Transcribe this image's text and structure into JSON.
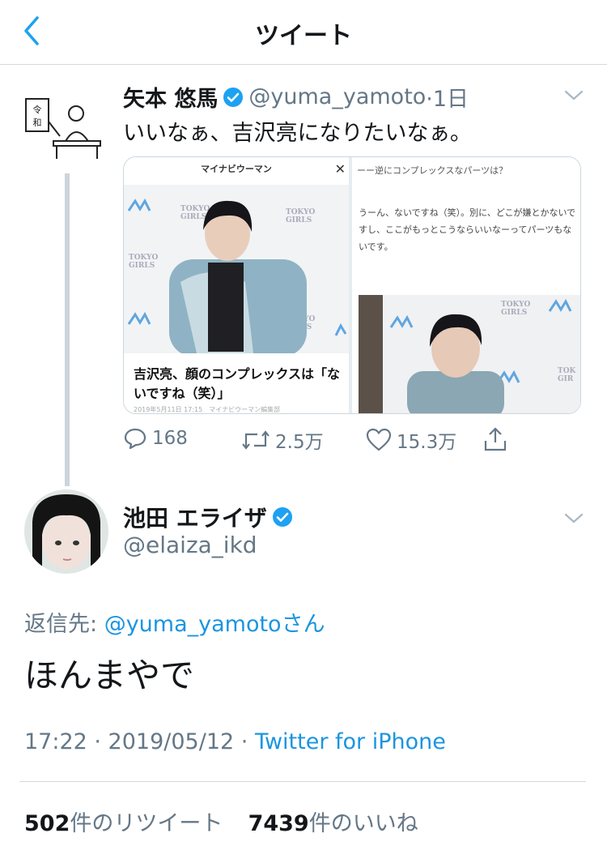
{
  "nav": {
    "title": "ツイート"
  },
  "quoted_tweet": {
    "name": "矢本 悠馬",
    "handle": "@yuma_yamoto",
    "time": "·1日",
    "text": "いいなぁ、吉沢亮になりたいなぁ。",
    "media": {
      "left_header": "マイナビウーマン",
      "left_close": "✕",
      "left_caption": "吉沢亮、顔のコンプレックスは「ないですね（笑）」",
      "left_meta": "2019年5月11日 17:15　マイナビウーマン編集部",
      "right_header": "ーー逆にコンプレックスなパーツは？",
      "right_text": "うーん、ないですね（笑）。別に、どこが嫌とかないですし、ここがもっとこうならいいなーってパーツもないです。"
    },
    "actions": {
      "replies": "168",
      "retweets": "2.5万",
      "likes": "15.3万"
    }
  },
  "main_tweet": {
    "name": "池田 エライザ",
    "handle": "@elaiza_ikd",
    "reply_prefix": "返信先: ",
    "reply_link": "@yuma_yamotoさん",
    "text": "ほんまやで",
    "timestamp": "17:22 · 2019/05/12 · ",
    "source": "Twitter for iPhone",
    "retweet_count": "502",
    "retweet_label": "件のリツイート",
    "like_count": "7439",
    "like_label": "件のいいね"
  },
  "colors": {
    "link": "#1b95e0",
    "secondary": "#657786",
    "verified": "#1da1f2"
  }
}
